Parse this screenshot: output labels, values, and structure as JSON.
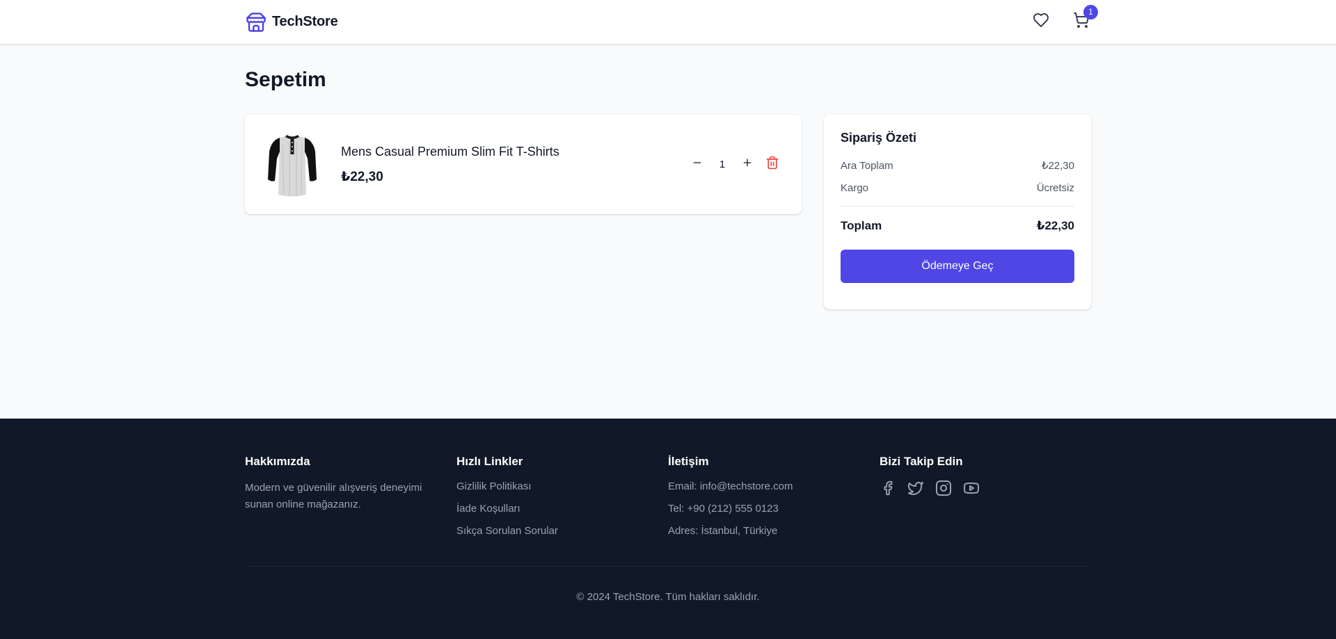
{
  "header": {
    "brand_name": "TechStore",
    "cart_count": "1",
    "icons": {
      "brand": "store-icon",
      "wishlist": "heart-icon",
      "cart": "shopping-cart-icon"
    }
  },
  "page": {
    "title": "Sepetim"
  },
  "cart": {
    "items": [
      {
        "name": "Mens Casual Premium Slim Fit T-Shirts",
        "price": "₺22,30",
        "quantity": "1",
        "image": "tshirt-image"
      }
    ]
  },
  "summary": {
    "title": "Sipariş Özeti",
    "subtotal_label": "Ara Toplam",
    "subtotal_value": "₺22,30",
    "shipping_label": "Kargo",
    "shipping_value": "Ücretsiz",
    "total_label": "Toplam",
    "total_value": "₺22,30",
    "checkout_label": "Ödemeye Geç"
  },
  "footer": {
    "about": {
      "heading": "Hakkımızda",
      "text": "Modern ve güvenilir alışveriş deneyimi sunan online mağazanız."
    },
    "links": {
      "heading": "Hızlı Linkler",
      "items": [
        "Gizlilik Politikası",
        "İade Koşulları",
        "Sıkça Sorulan Sorular"
      ]
    },
    "contact": {
      "heading": "İletişim",
      "email": "Email: info@techstore.com",
      "phone": "Tel: +90 (212) 555 0123",
      "address": "Adres: İstanbul, Türkiye"
    },
    "social": {
      "heading": "Bizi Takip Edin",
      "icons": [
        "facebook-icon",
        "twitter-icon",
        "instagram-icon",
        "youtube-icon"
      ]
    },
    "copyright": "© 2024 TechStore. Tüm hakları saklıdır."
  },
  "colors": {
    "accent": "#4f46e5",
    "danger": "#ef4444",
    "footer_bg": "#111827",
    "page_bg": "#f9fafb"
  }
}
